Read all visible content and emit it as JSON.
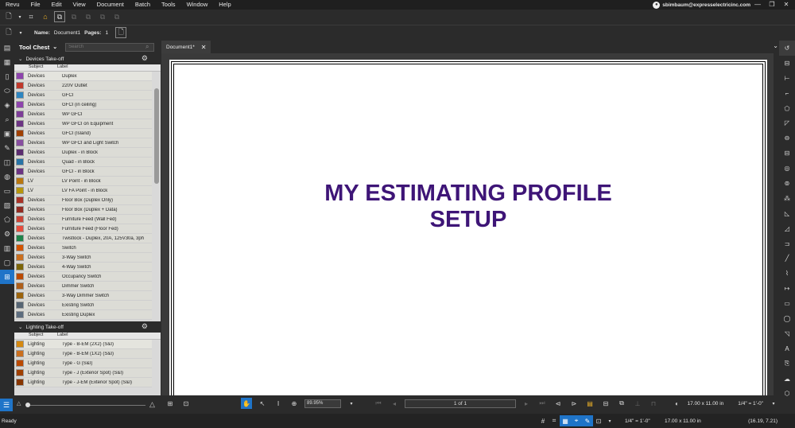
{
  "menu": [
    "Revu",
    "File",
    "Edit",
    "View",
    "Document",
    "Batch",
    "Tools",
    "Window",
    "Help"
  ],
  "user": {
    "email": "sbimbaum@expresselectricinc.com"
  },
  "toolbar2": {
    "name_label": "Name:",
    "name_value": "Document1",
    "pages_label": "Pages:",
    "pages_value": "1"
  },
  "tool_chest": {
    "title": "Tool Chest",
    "search_placeholder": "Search",
    "devices": {
      "title": "Devices Take-off",
      "col_subject": "Subject",
      "col_label": "Label",
      "rows": [
        {
          "subject": "Devices",
          "label": "Duplex",
          "color": "#8e44ad"
        },
        {
          "subject": "Devices",
          "label": "220V Outlet",
          "color": "#c0392b"
        },
        {
          "subject": "Devices",
          "label": "GFCI",
          "color": "#2e86c1"
        },
        {
          "subject": "Devices",
          "label": "GFCI (in ceiling)",
          "color": "#8e44ad"
        },
        {
          "subject": "Devices",
          "label": "WP GFCI",
          "color": "#7d3c98"
        },
        {
          "subject": "Devices",
          "label": "WP GFCI on Equipment",
          "color": "#6c3483"
        },
        {
          "subject": "Devices",
          "label": "GFCI  (Island)",
          "color": "#a04000"
        },
        {
          "subject": "Devices",
          "label": "WP GFCI and Light Switch",
          "color": "#884ea0"
        },
        {
          "subject": "Devices",
          "label": "Duplex - in Block",
          "color": "#5b2c6f"
        },
        {
          "subject": "Devices",
          "label": "Quad - in Block",
          "color": "#2874a6"
        },
        {
          "subject": "Devices",
          "label": "GFCI - in Block",
          "color": "#6c3483"
        },
        {
          "subject": "LV",
          "label": "LV Point - in Block",
          "color": "#b9770e"
        },
        {
          "subject": "LV",
          "label": "LV FA Point - in Block",
          "color": "#b7950b"
        },
        {
          "subject": "Devices",
          "label": "Floor Box (Duplex Only)",
          "color": "#a93226"
        },
        {
          "subject": "Devices",
          "label": "Floor Box (Duplex + Data)",
          "color": "#922b21"
        },
        {
          "subject": "Devices",
          "label": "Furniture Feed (Wall Fed)",
          "color": "#cb4335"
        },
        {
          "subject": "Devices",
          "label": "Furniture Feed (Floor Fed)",
          "color": "#e74c3c"
        },
        {
          "subject": "Devices",
          "label": "Twistlock - Duplex, 20A, 125V30a, 3ph",
          "color": "#1e8449"
        },
        {
          "subject": "Devices",
          "label": "Switch",
          "color": "#d35400"
        },
        {
          "subject": "Devices",
          "label": "3-Way Switch",
          "color": "#ca6f1e"
        },
        {
          "subject": "Devices",
          "label": "4-Way Switch",
          "color": "#7d6608"
        },
        {
          "subject": "Devices",
          "label": "Occupancy Switch",
          "color": "#ba4a00"
        },
        {
          "subject": "Devices",
          "label": "Dimmer Switch",
          "color": "#af601a"
        },
        {
          "subject": "Devices",
          "label": "3-Way Dimmer Switch",
          "color": "#9c640c"
        },
        {
          "subject": "Devices",
          "label": "Existing Switch",
          "color": "#566573"
        },
        {
          "subject": "Devices",
          "label": "Existing Duplex",
          "color": "#5d6d7e"
        }
      ]
    },
    "lighting": {
      "title": "Lighting Take-off",
      "col_subject": "Subject",
      "col_label": "Label",
      "rows": [
        {
          "subject": "Lighting",
          "label": "Type - B-EM (2X2) (S&I)",
          "color": "#d68910"
        },
        {
          "subject": "Lighting",
          "label": "Type - B-EM (1X2) (S&I)",
          "color": "#ca6f1e"
        },
        {
          "subject": "Lighting",
          "label": "Type - G (S&I)",
          "color": "#ba4a00"
        },
        {
          "subject": "Lighting",
          "label": "Type - J (Exterior Spot) (S&I)",
          "color": "#a04000"
        },
        {
          "subject": "Lighting",
          "label": "Type - J-EM (Exterior Spot) (S&I)",
          "color": "#873600"
        }
      ]
    }
  },
  "doc_tab": {
    "label": "Document1*"
  },
  "document": {
    "title_line1": "MY ESTIMATING PROFILE",
    "title_line2": "SETUP"
  },
  "navbar": {
    "zoom": "89.95%",
    "page": "1 of 1",
    "paper_size": "17.00 x 11.00 in",
    "scale": "1/4\" = 1'-0\""
  },
  "status": {
    "ready": "Ready",
    "scale": "1/4\" = 1'-0\"",
    "size": "17.00 x 11.00 in",
    "coords": "(16.19, 7.21)"
  }
}
